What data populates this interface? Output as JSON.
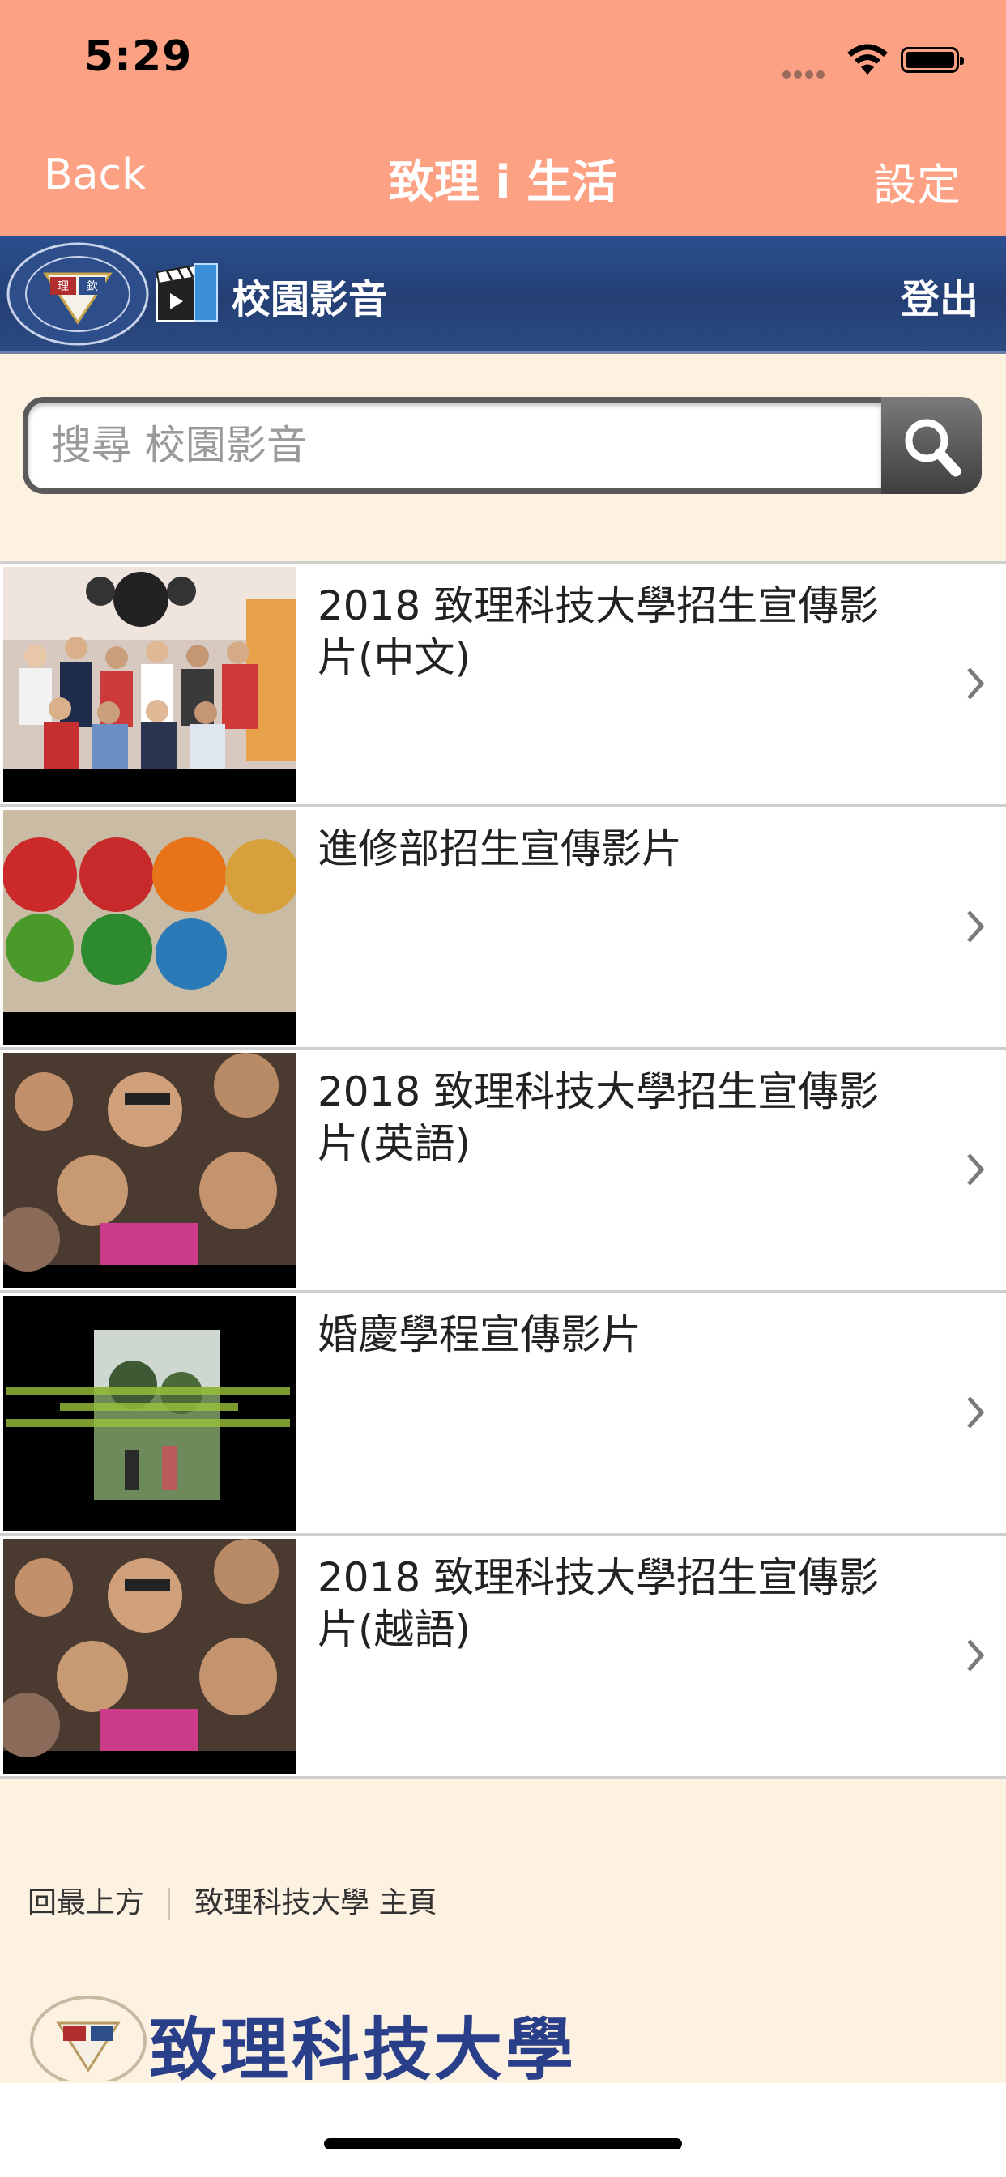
{
  "status_bar": {
    "time": "5:29"
  },
  "nav": {
    "back_label": "Back",
    "title": "致理 i 生活",
    "settings_label": "設定"
  },
  "header": {
    "section_title": "校園影音",
    "logout_label": "登出"
  },
  "search": {
    "placeholder": "搜尋 校園影音"
  },
  "videos": [
    {
      "title": "2018 致理科技大學招生宣傳影片(中文)"
    },
    {
      "title": "進修部招生宣傳影片"
    },
    {
      "title": "2018 致理科技大學招生宣傳影片(英語)"
    },
    {
      "title": "婚慶學程宣傳影片"
    },
    {
      "title": "2018 致理科技大學招生宣傳影片(越語)"
    }
  ],
  "footer": {
    "back_to_top": "回最上方",
    "home_link": "致理科技大學 主頁",
    "logo_text": "致理科技大學"
  },
  "colors": {
    "nav_bg": "#fda184",
    "header_bg": "#2a4f8e",
    "page_bg": "#fdf1e2"
  },
  "icons": [
    "wifi-icon",
    "battery-icon",
    "university-seal-icon",
    "video-clapper-icon",
    "search-icon",
    "chevron-right-icon"
  ]
}
